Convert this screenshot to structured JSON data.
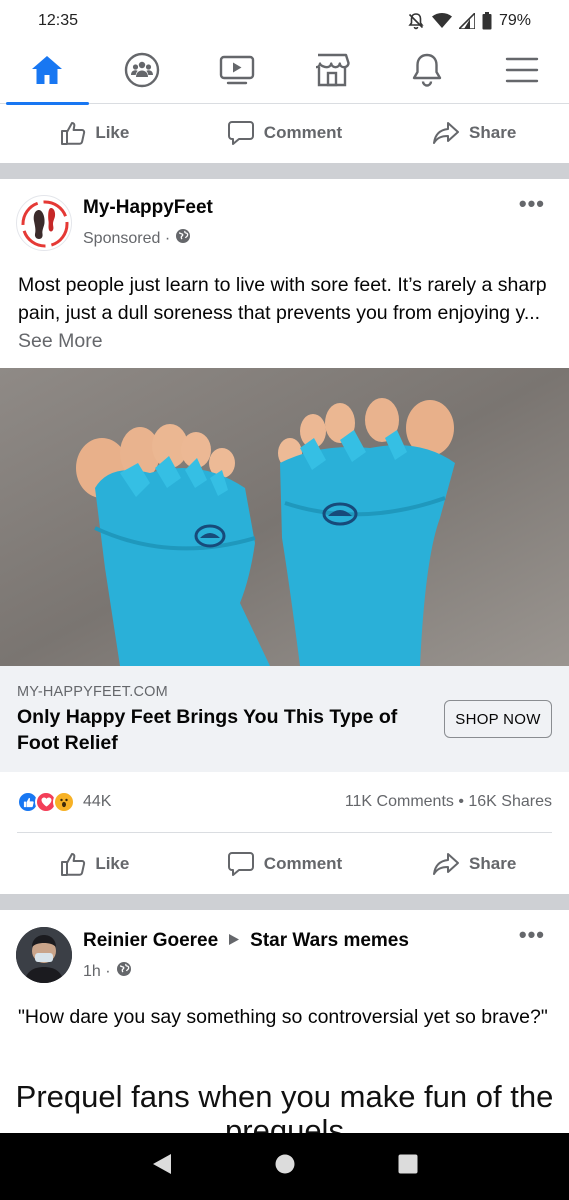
{
  "status_bar": {
    "time": "12:35",
    "battery": "79%",
    "icons": [
      "mute-bell-icon",
      "wifi-icon",
      "signal-icon",
      "battery-icon"
    ]
  },
  "nav": {
    "tabs": [
      {
        "name": "home",
        "icon": "home-icon",
        "active": true
      },
      {
        "name": "groups",
        "icon": "groups-icon",
        "active": false
      },
      {
        "name": "watch",
        "icon": "video-icon",
        "active": false
      },
      {
        "name": "marketplace",
        "icon": "marketplace-icon",
        "active": false
      },
      {
        "name": "notifications",
        "icon": "bell-icon",
        "active": false
      },
      {
        "name": "menu",
        "icon": "hamburger-icon",
        "active": false
      }
    ]
  },
  "actions": {
    "like": "Like",
    "comment": "Comment",
    "share": "Share"
  },
  "sponsored_post": {
    "author": "My-HappyFeet",
    "meta": "Sponsored ·",
    "text": "Most people just learn to live with sore feet. It’s rarely a sharp pain, just a dull soreness that prevents you from enjoying y... ",
    "see_more": "See More",
    "link": {
      "domain": "MY-HAPPYFEET.COM",
      "headline": "Only Happy Feet Brings You This Type of Foot Relief",
      "cta": "SHOP NOW"
    },
    "reactions_count": "44K",
    "comments_shares": "11K Comments • 16K Shares"
  },
  "next_post": {
    "author": "Reinier Goeree",
    "group": "Star Wars memes",
    "meta": "1h ·",
    "text": "\"How dare you say something so controversial yet so brave?\"",
    "meme_caption": "Prequel fans when you make fun of the prequels"
  },
  "colors": {
    "accent": "#1877f2",
    "muted_text": "#65676b",
    "divider": "#ced0d4",
    "link_card_bg": "#f0f2f5",
    "sock_blue": "#2ab0d8"
  }
}
